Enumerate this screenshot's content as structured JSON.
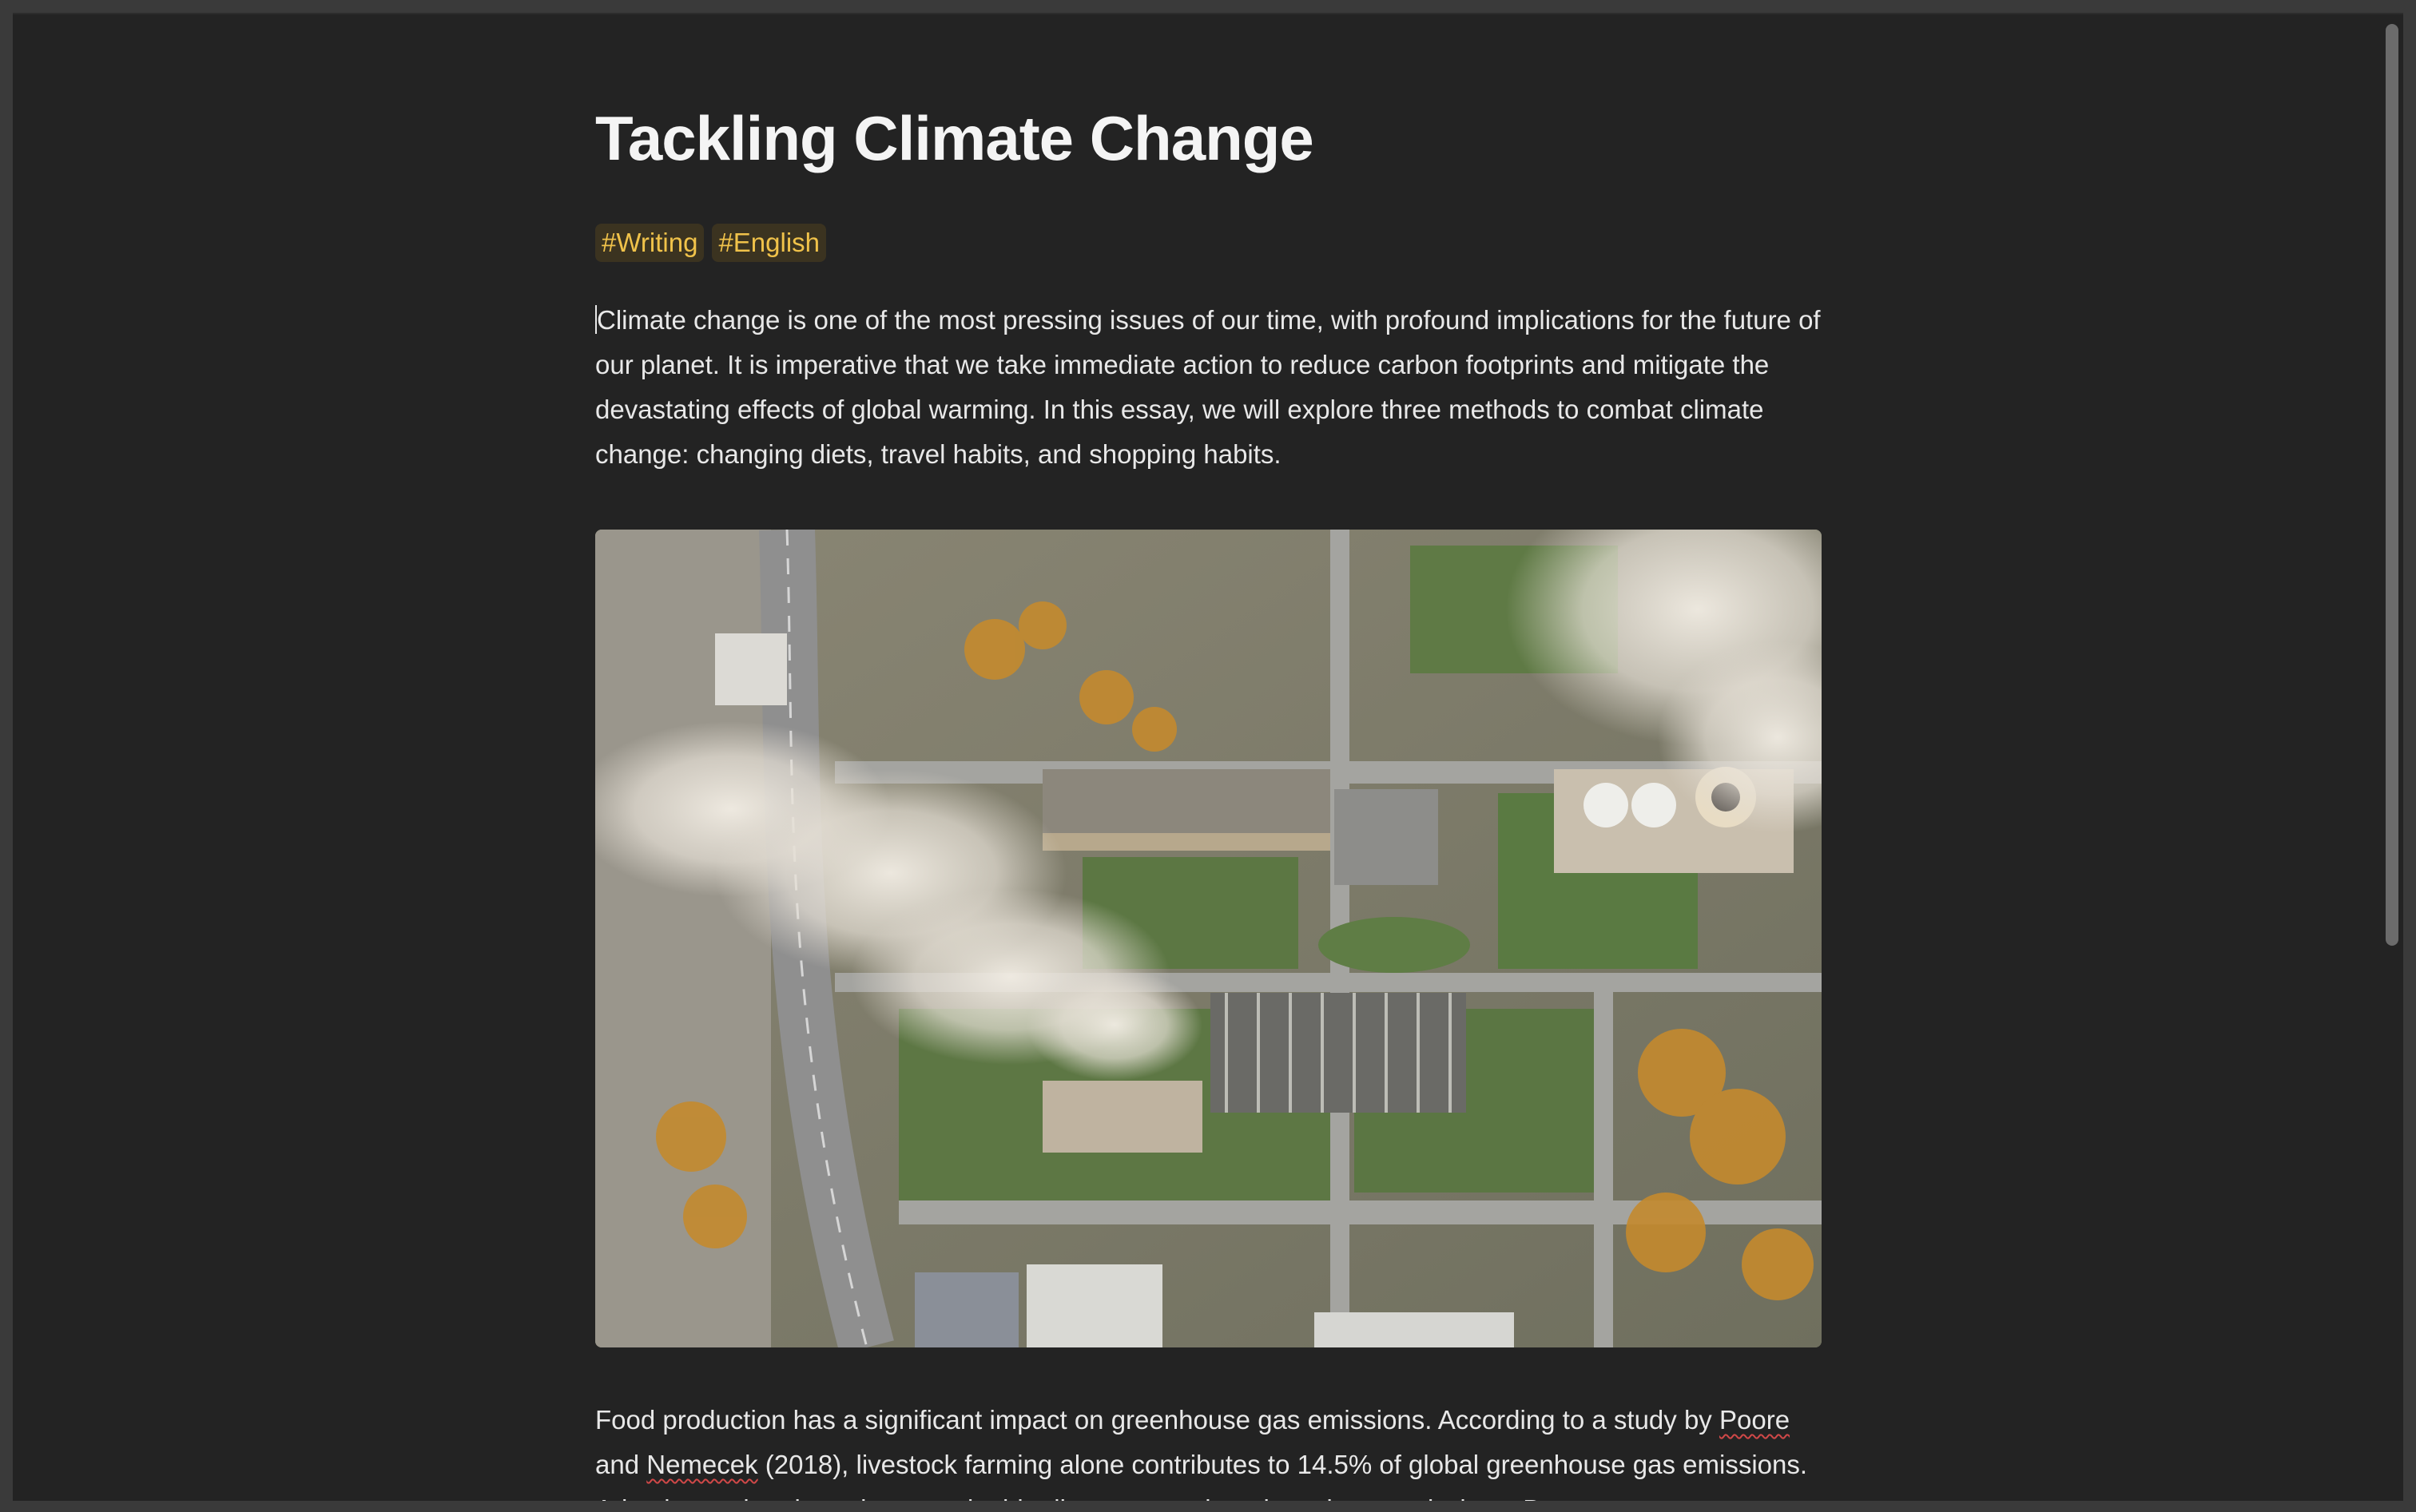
{
  "document": {
    "title": "Tackling Climate Change",
    "tags": [
      "#Writing",
      "#English"
    ],
    "intro": "Climate change is one of the most pressing issues of our time, with profound implications for the future of our planet. It is imperative that we take immediate action to reduce carbon footprints and mitigate the devastating effects of global warming. In this essay, we will explore three methods to combat climate change: changing diets, travel habits, and shopping habits.",
    "body": {
      "part1": "Food production has a significant impact on greenhouse gas emissions. According to a study by ",
      "author1": "Poore",
      "part2": " and ",
      "author2": "Nemecek",
      "part3": " (2018), livestock farming alone contributes to 14.5% of global greenhouse gas emissions. Adopting a plant-based or sustainable diet can greatly reduce these emissions. By"
    }
  },
  "colors": {
    "background": "#232323",
    "text": "#e8e8e8",
    "tag_text": "#f0c24a",
    "tag_bg": "#3b3320"
  }
}
